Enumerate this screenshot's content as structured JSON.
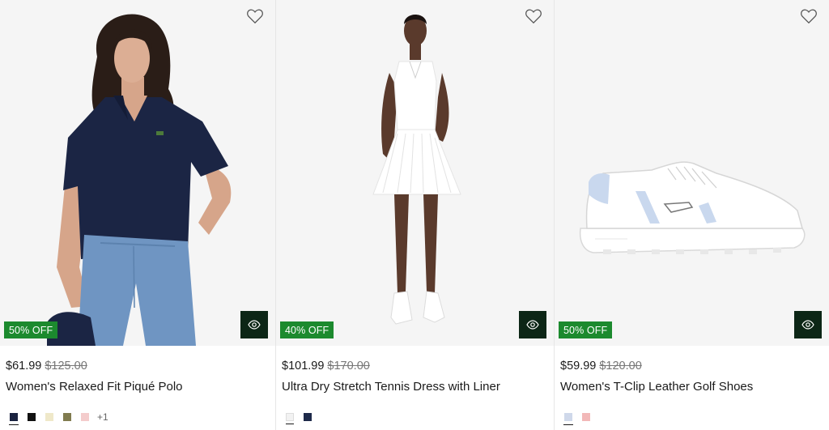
{
  "products": [
    {
      "badge": "50% OFF",
      "price": "$61.99",
      "original_price": "$125.00",
      "name": "Women's Relaxed Fit Piqué Polo",
      "swatches": [
        "#1a2240",
        "#111111",
        "#efe8c9",
        "#807b4f",
        "#f4cccc"
      ],
      "more_colors": "+1",
      "wishlist_icon": "heart-icon",
      "quick_view_icon": "eye-icon"
    },
    {
      "badge": "40% OFF",
      "price": "$101.99",
      "original_price": "$170.00",
      "name": "Ultra Dry Stretch Tennis Dress with Liner",
      "swatches": [
        "#f2f2f2",
        "#1e2a4a"
      ],
      "wishlist_icon": "heart-icon",
      "quick_view_icon": "eye-icon"
    },
    {
      "badge": "50% OFF",
      "price": "$59.99",
      "original_price": "$120.00",
      "name": "Women's T-Clip Leather Golf Shoes",
      "swatches": [
        "#cfd8ea",
        "#f2b8b8"
      ],
      "wishlist_icon": "heart-icon",
      "quick_view_icon": "eye-icon"
    }
  ],
  "colors": {
    "badge_green": "#1c8a2e",
    "quick_view_bg": "#0c2616",
    "image_bg": "#f5f5f5"
  }
}
